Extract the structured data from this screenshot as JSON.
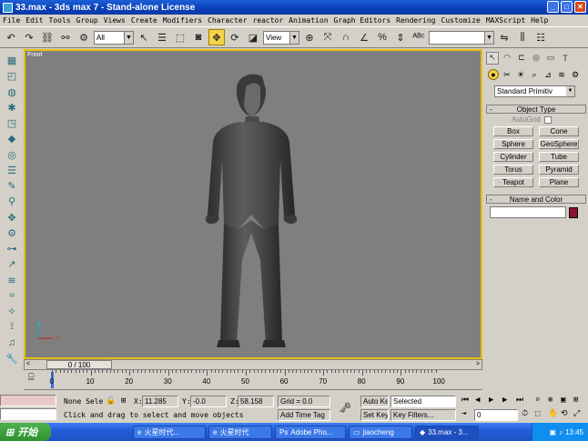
{
  "window": {
    "title": "33.max - 3ds max 7 - Stand-alone License",
    "controls": [
      "_",
      "□",
      "✕"
    ]
  },
  "menubar": [
    "File",
    "Edit",
    "Tools",
    "Group",
    "Views",
    "Create",
    "Modifiers",
    "Character",
    "reactor",
    "Animation",
    "Graph Editors",
    "Rendering",
    "Customize",
    "MAXScript",
    "Help"
  ],
  "toolbar": {
    "selection_filter": "All",
    "ref_coord": "View",
    "named_sel": ""
  },
  "viewport": {
    "label": "Front",
    "axis_x": "x",
    "axis_z": "z"
  },
  "command_panel": {
    "dropdown": "Standard Primitiv",
    "object_type": {
      "title": "Object Type",
      "autogrid": "AutoGrid",
      "buttons": [
        "Box",
        "Cone",
        "Sphere",
        "GeoSphere",
        "Cylinder",
        "Tube",
        "Torus",
        "Pyramid",
        "Teapot",
        "Plane"
      ]
    },
    "name_color": {
      "title": "Name and Color",
      "name_value": "",
      "color": "#8a1035"
    }
  },
  "timeslider": {
    "label": "0 / 100",
    "left": "<",
    "right": ">"
  },
  "trackbar": {
    "ticks": [
      "0",
      "10",
      "20",
      "30",
      "40",
      "50",
      "60",
      "70",
      "80",
      "90",
      "100"
    ]
  },
  "status": {
    "selection": "None Sele",
    "x_label": "X:",
    "x_value": "11.285",
    "y_label": "Y:",
    "y_value": "-0.0",
    "z_label": "Z:",
    "z_value": "58.158",
    "grid": "Grid = 0.0",
    "prompt": "Click and drag to select and move objects",
    "add_time_tag": "Add Time Tag",
    "auto_key": "Auto Key",
    "set_key": "Set Key",
    "key_mode": "Selected",
    "key_filters": "Key Filters...",
    "frame": "0"
  },
  "taskbar": {
    "start": "开始",
    "tasks": [
      "火星时代...",
      "火星时代",
      "Adobe Pho...",
      "jiaocheng",
      "33.max - 3..."
    ],
    "clock": "13:45"
  }
}
